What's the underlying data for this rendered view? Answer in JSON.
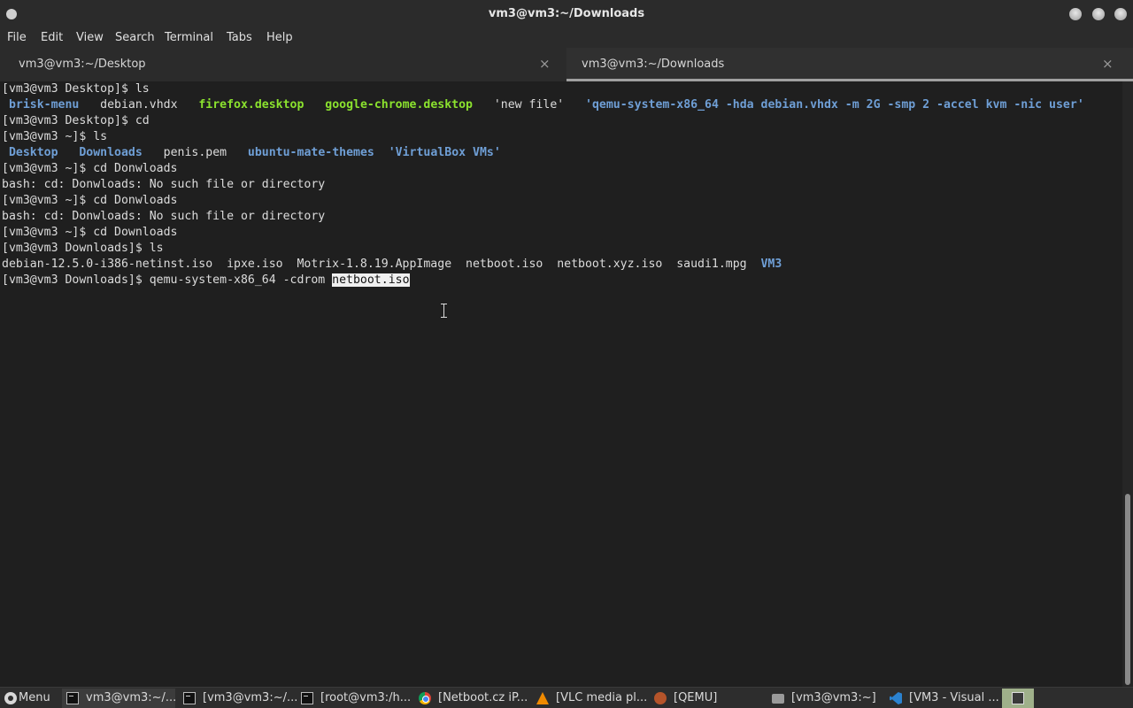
{
  "window": {
    "title": "vm3@vm3:~/Downloads"
  },
  "menu": [
    "File",
    "Edit",
    "View",
    "Search",
    "Terminal",
    "Tabs",
    "Help"
  ],
  "tabs": [
    {
      "label": "vm3@vm3:~/Desktop",
      "active": false,
      "close": "×"
    },
    {
      "label": "vm3@vm3:~/Downloads",
      "active": true,
      "close": "×"
    }
  ],
  "terminal": {
    "lines": [
      [
        {
          "t": "[vm3@vm3 Desktop]$ ls"
        }
      ],
      [
        {
          "t": " "
        },
        {
          "t": "brisk-menu",
          "c": "blue"
        },
        {
          "t": "   debian.vhdx   "
        },
        {
          "t": "firefox.desktop",
          "c": "green"
        },
        {
          "t": "   "
        },
        {
          "t": "google-chrome.desktop",
          "c": "green"
        },
        {
          "t": "   'new file'   "
        },
        {
          "t": "'qemu-system-x86_64 -hda debian.vhdx -m 2G -smp 2 -accel kvm -nic user'",
          "c": "blue"
        }
      ],
      [
        {
          "t": "[vm3@vm3 Desktop]$ cd"
        }
      ],
      [
        {
          "t": "[vm3@vm3 ~]$ ls"
        }
      ],
      [
        {
          "t": " "
        },
        {
          "t": "Desktop",
          "c": "blue"
        },
        {
          "t": "   "
        },
        {
          "t": "Downloads",
          "c": "blue"
        },
        {
          "t": "   penis.pem   "
        },
        {
          "t": "ubuntu-mate-themes",
          "c": "blue"
        },
        {
          "t": "  "
        },
        {
          "t": "'VirtualBox VMs'",
          "c": "blue"
        }
      ],
      [
        {
          "t": "[vm3@vm3 ~]$ cd Donwloads"
        }
      ],
      [
        {
          "t": "bash: cd: Donwloads: No such file or directory"
        }
      ],
      [
        {
          "t": "[vm3@vm3 ~]$ cd Donwloads"
        }
      ],
      [
        {
          "t": "bash: cd: Donwloads: No such file or directory"
        }
      ],
      [
        {
          "t": "[vm3@vm3 ~]$ cd Downloads"
        }
      ],
      [
        {
          "t": "[vm3@vm3 Downloads]$ ls"
        }
      ],
      [
        {
          "t": "debian-12.5.0-i386-netinst.iso  ipxe.iso  Motrix-1.8.19.AppImage  netboot.iso  netboot.xyz.iso  saudi1.mpg  "
        },
        {
          "t": "VM3",
          "c": "blue"
        }
      ],
      [
        {
          "t": "[vm3@vm3 Downloads]$ qemu-system-x86_64 -cdrom "
        },
        {
          "t": "netboot.iso",
          "c": "sel"
        }
      ]
    ]
  },
  "taskbar": {
    "items": [
      {
        "label": "Menu",
        "icon": "menu-icon"
      },
      {
        "label": "vm3@vm3:~/...",
        "icon": "terminal-icon",
        "active": true
      },
      {
        "label": "[vm3@vm3:~/...",
        "icon": "terminal-icon"
      },
      {
        "label": "[root@vm3:/h...",
        "icon": "terminal-icon"
      },
      {
        "label": "[Netboot.cz iP...",
        "icon": "chrome-icon"
      },
      {
        "label": "[VLC media pl...",
        "icon": "vlc-icon"
      },
      {
        "label": "[QEMU]",
        "icon": "qemu-icon"
      },
      {
        "label": "[vm3@vm3:~]",
        "icon": "folder-icon"
      },
      {
        "label": "[VM3 - Visual ...",
        "icon": "vscode-icon"
      }
    ]
  },
  "colors": {
    "dir": "#6f9fd6",
    "exec": "#8be22e",
    "bg": "#1f1f1f"
  }
}
